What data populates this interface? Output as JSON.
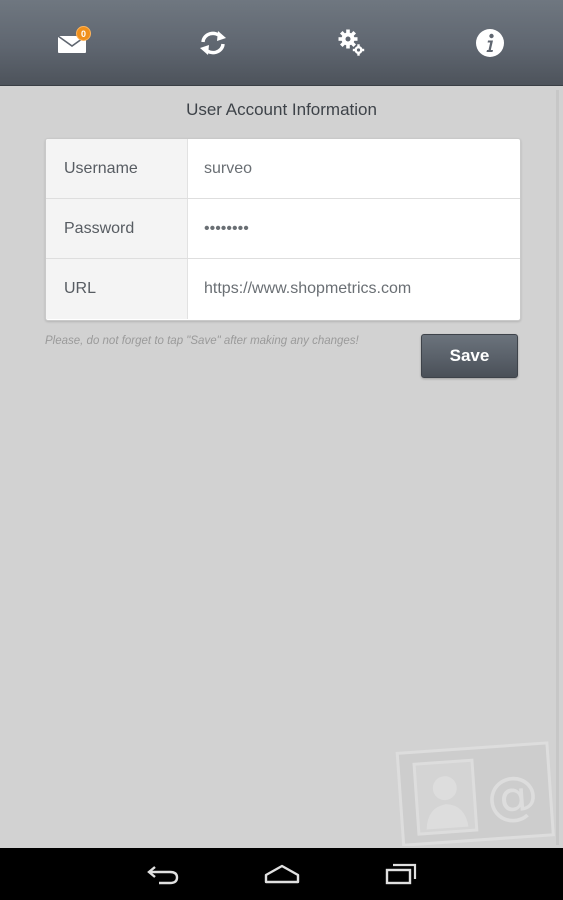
{
  "toolbar": {
    "icons": [
      "mail-icon",
      "sync-icon",
      "settings-icon",
      "info-icon"
    ],
    "mail_badge": "0"
  },
  "account": {
    "title": "User Account Information",
    "fields": [
      {
        "label": "Username",
        "value": "surveo"
      },
      {
        "label": "Password",
        "value": "••••••••"
      },
      {
        "label": "URL",
        "value": "https://www.shopmetrics.com"
      }
    ],
    "note": "Please, do not forget to tap \"Save\" after making any changes!",
    "save_label": "Save"
  },
  "navbar": {
    "icons": [
      "back-icon",
      "home-icon",
      "recent-apps-icon"
    ]
  },
  "colors": {
    "toolbar": "#5f6670",
    "background": "#d2d2d2",
    "badge": "#f0901c",
    "save_button": "#5b626b"
  }
}
